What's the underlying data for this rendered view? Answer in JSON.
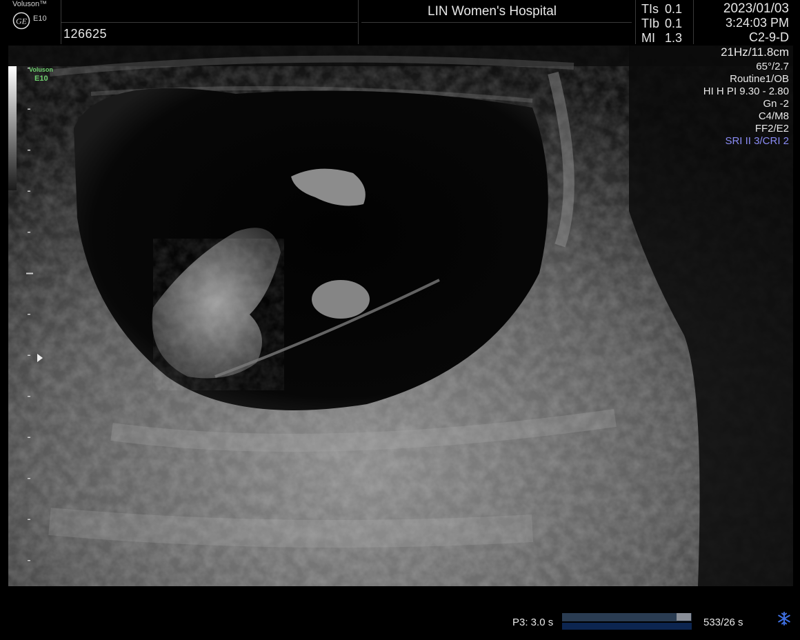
{
  "header": {
    "brand": "Voluson™",
    "model": "E10",
    "patient_id": "126625",
    "hospital": "LIN Women's Hospital",
    "indices": [
      {
        "name": "TIs",
        "value": "0.1"
      },
      {
        "name": "TIb",
        "value": "0.1"
      },
      {
        "name": "MI",
        "value": "1.3"
      }
    ],
    "date": "2023/01/03",
    "time": "3:24:03 PM",
    "probe": "C2-9-D"
  },
  "params": {
    "freq_depth": "21Hz/11.8cm",
    "angle": "65°/2.7",
    "preset": "Routine1/OB",
    "harmonic": "HI H PI 9.30 - 2.80",
    "gain": "Gn  -2",
    "map": "C4/M8",
    "filter": "FF2/E2",
    "sri": "SRI II 3/CRI 2"
  },
  "scan_overlay": {
    "brand": "Voluson",
    "model": "E10"
  },
  "footer": {
    "cine_label": "P3:  3.0 s",
    "cine_position": 0.89,
    "frame_count": "533/26 s"
  },
  "colors": {
    "background": "#000000",
    "text": "#e8e8e8",
    "sri_accent": "#8a8cf5",
    "overlay_green": "#6fd06f"
  },
  "icons": [
    "ge-logo-icon",
    "freeze-icon",
    "focus-marker-icon"
  ]
}
